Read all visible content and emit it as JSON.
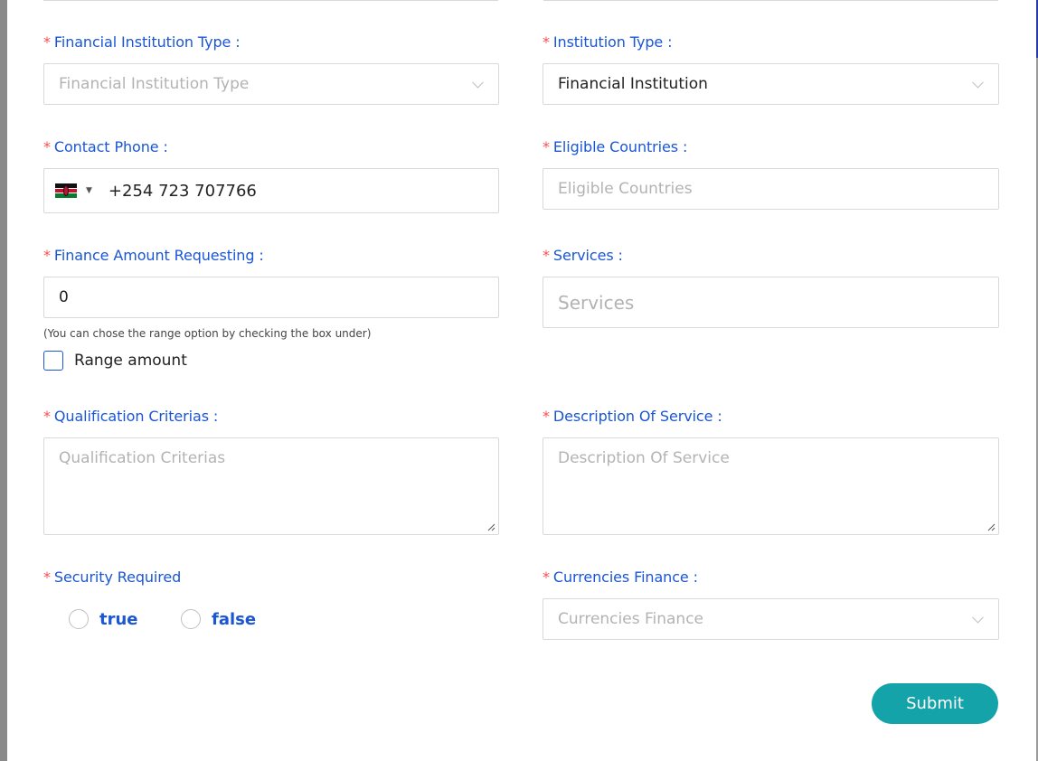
{
  "form": {
    "financial_institution_type": {
      "label": "Financial Institution Type :",
      "placeholder": "Financial Institution Type"
    },
    "institution_type": {
      "label": "Institution Type :",
      "value": "Financial Institution"
    },
    "contact_phone": {
      "label": "Contact Phone :",
      "value": "+254 723 707766",
      "country_flag": "kenya-flag-icon"
    },
    "eligible_countries": {
      "label": "Eligible Countries :",
      "placeholder": "Eligible Countries"
    },
    "finance_amount": {
      "label": "Finance Amount Requesting :",
      "value": "0",
      "hint": "(You can chose the range option by checking the box under)",
      "range_label": "Range amount"
    },
    "services": {
      "label": "Services :",
      "placeholder": "Services"
    },
    "qualification_criterias": {
      "label": "Qualification Criterias :",
      "placeholder": "Qualification Criterias"
    },
    "description_of_service": {
      "label": "Description Of Service :",
      "placeholder": "Description Of Service"
    },
    "security_required": {
      "label": "Security Required",
      "options": [
        "true",
        "false"
      ]
    },
    "currencies_finance": {
      "label": "Currencies Finance :",
      "placeholder": "Currencies Finance"
    },
    "required_mark": "*",
    "submit_label": "Submit"
  },
  "colors": {
    "label": "#1a56d6",
    "required": "#ff4d4f",
    "submit": "#14a3a8",
    "border": "#d9d9d9"
  }
}
